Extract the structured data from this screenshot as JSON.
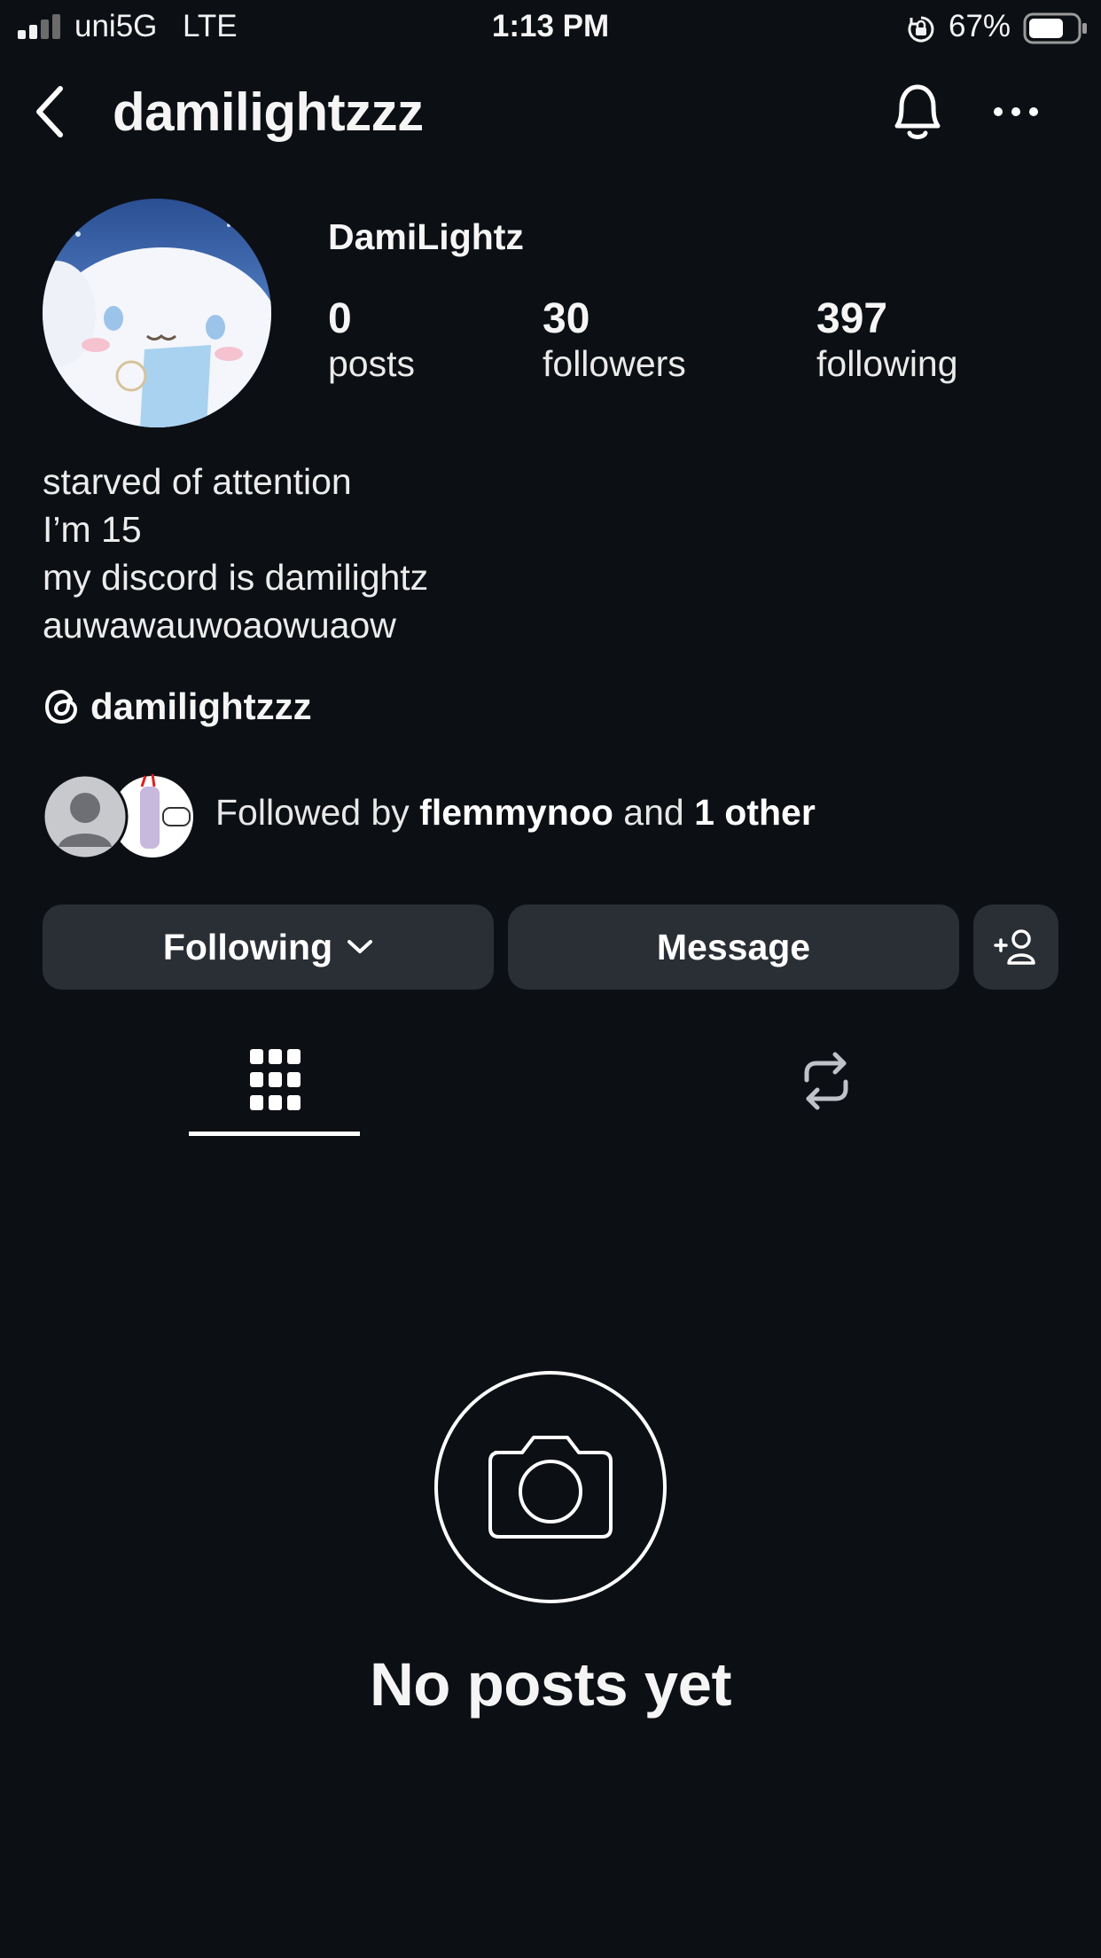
{
  "status_bar": {
    "carrier": "uni5G",
    "network": "LTE",
    "time": "1:13 PM",
    "battery_percent": "67%",
    "icons": [
      "signal-icon",
      "rotation-lock-icon",
      "battery-icon"
    ]
  },
  "header": {
    "username": "damilightzzz",
    "icons": [
      "back-icon",
      "bell-icon",
      "more-icon"
    ]
  },
  "profile": {
    "display_name": "DamiLightz",
    "stats": [
      {
        "value": "0",
        "label": "posts"
      },
      {
        "value": "30",
        "label": "followers"
      },
      {
        "value": "397",
        "label": "following"
      }
    ],
    "bio": [
      "starved of attention",
      "I’m 15",
      "my discord is damilightz",
      "auwawauwoaowuaow"
    ],
    "threads_handle": "damilightzzz",
    "followed_by": {
      "prefix": "Followed by ",
      "name": "flemmynoo",
      "middle": " and ",
      "other": "1 other"
    }
  },
  "actions": {
    "following_label": "Following",
    "message_label": "Message"
  },
  "tabs": [
    {
      "name": "grid",
      "icon": "grid-icon",
      "active": true
    },
    {
      "name": "reposts",
      "icon": "repost-icon",
      "active": false
    }
  ],
  "empty_state": {
    "title": "No posts yet",
    "icon": "camera-icon"
  },
  "colors": {
    "background": "#0c0f14",
    "button": "#2a2e35",
    "text": "#f5f5f5"
  }
}
